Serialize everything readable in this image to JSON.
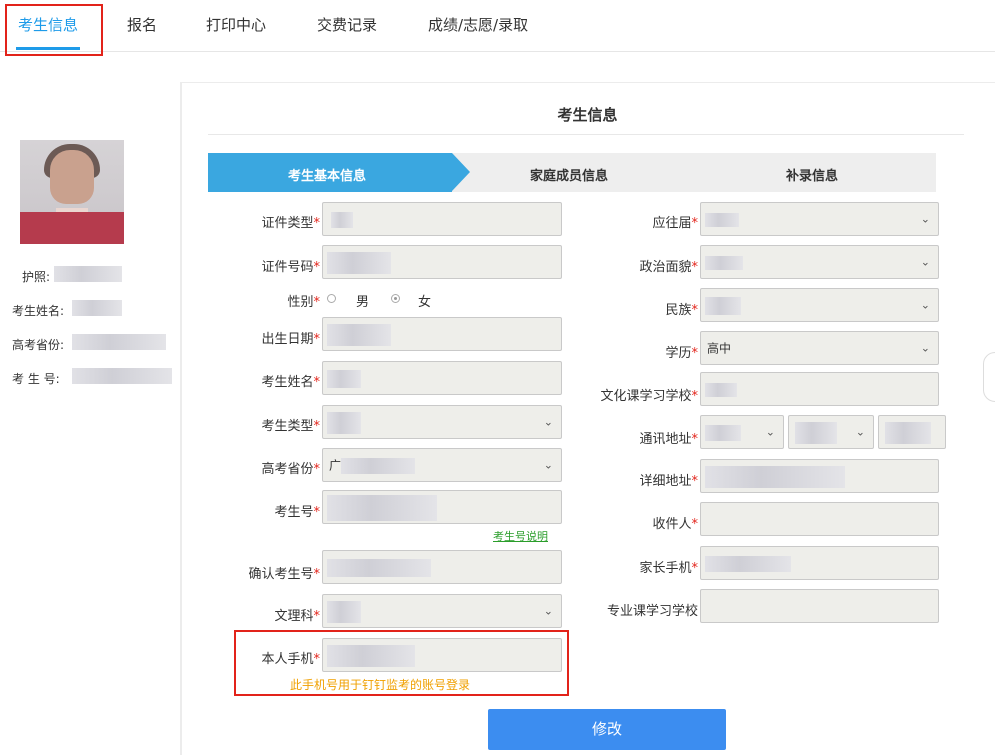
{
  "nav": {
    "tabs": [
      "考生信息",
      "报名",
      "打印中心",
      "交费记录",
      "成绩/志愿/录取"
    ],
    "active_tab": "考生信息"
  },
  "sidebar": {
    "passport_label": "护照:",
    "name_label": "考生姓名:",
    "province_label": "高考省份:",
    "number_label": "考 生 号:"
  },
  "panel": {
    "title": "考生信息",
    "steps": [
      "考生基本信息",
      "家庭成员信息",
      "补录信息"
    ],
    "active_step": "考生基本信息"
  },
  "form_left": {
    "id_type": "证件类型",
    "id_number": "证件号码",
    "gender": "性别",
    "gender_options": [
      "男",
      "女"
    ],
    "gender_selected": "女",
    "birth_date": "出生日期",
    "name": "考生姓名",
    "student_type": "考生类型",
    "province": "高考省份",
    "exam_no": "考生号",
    "exam_no_help": "考生号说明",
    "confirm_exam_no": "确认考生号",
    "subject_track": "文理科",
    "mobile": "本人手机",
    "mobile_note": "此手机号用于钉钉监考的账号登录",
    "province_value_prefix": "广"
  },
  "form_right": {
    "graduation_year": "应往届",
    "political_status": "政治面貌",
    "ethnicity": "民族",
    "education": "学历",
    "education_value": "高中",
    "culture_school": "文化课学习学校",
    "address": "通讯地址",
    "detail_address": "详细地址",
    "recipient": "收件人",
    "parent_phone": "家长手机",
    "major_school": "专业课学习学校"
  },
  "required_mark": "*",
  "submit_label": "修改",
  "colors": {
    "accent": "#1e9be9",
    "step_active": "#3aa7e0",
    "submit": "#3c8df0",
    "highlight_box": "#e2231a",
    "note": "#f0a000",
    "link": "#2a9d2a"
  }
}
